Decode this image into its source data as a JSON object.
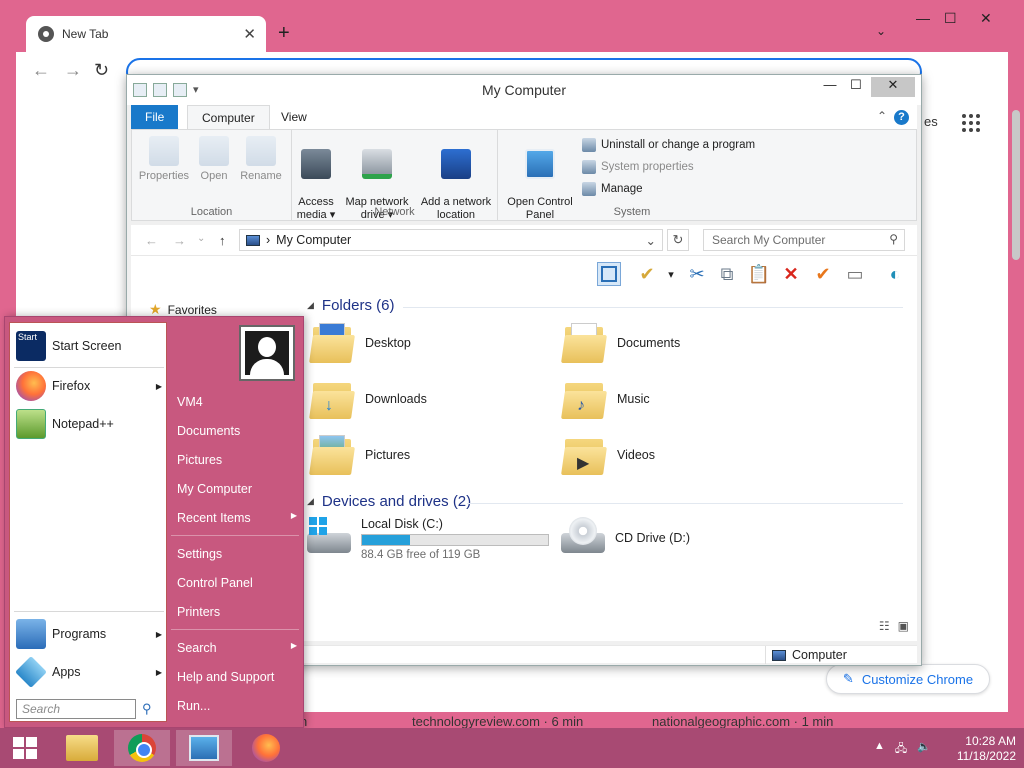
{
  "chrome": {
    "tab_title": "New Tab",
    "tab_close": "✕",
    "new_tab": "+",
    "tab_search": "⌄",
    "minimize": "—",
    "maximize": "☐",
    "close": "✕",
    "back": "←",
    "forward": "→",
    "reload": "↻",
    "signin_fragment": "es",
    "customize_label": "Customize Chrome",
    "news": [
      "n",
      "technologyreview.com · 6 min",
      "nationalgeographic.com · 1 min"
    ]
  },
  "explorer": {
    "title": "My Computer",
    "minimize": "—",
    "maximize": "☐",
    "close": "✕",
    "tabs": {
      "file": "File",
      "computer": "Computer",
      "view": "View"
    },
    "help": "?",
    "collapse": "⌃",
    "ribbon": {
      "location": {
        "label": "Location",
        "properties": "Properties",
        "open": "Open",
        "rename": "Rename"
      },
      "network": {
        "label": "Network",
        "access_media": "Access\nmedia ▾",
        "map_network_drive": "Map network\ndrive ▾",
        "add_network_location": "Add a network\nlocation"
      },
      "system": {
        "label": "System",
        "open_control_panel": "Open Control\nPanel",
        "uninstall": "Uninstall or change a program",
        "system_properties": "System properties",
        "manage": "Manage"
      }
    },
    "address": {
      "back": "←",
      "forward": "→",
      "recent": "⌄",
      "up": "↑",
      "separator": "›",
      "path": "My Computer",
      "dropdown": "⌄",
      "refresh": "↻",
      "search_placeholder": "Search My Computer",
      "search_icon": "⚲"
    },
    "nav": {
      "favorites": "Favorites"
    },
    "folders_header": "Folders (6)",
    "folders": [
      {
        "name": "Desktop",
        "badge": ""
      },
      {
        "name": "Documents",
        "badge": ""
      },
      {
        "name": "Downloads",
        "badge": "↓"
      },
      {
        "name": "Music",
        "badge": "♪"
      },
      {
        "name": "Pictures",
        "badge": ""
      },
      {
        "name": "Videos",
        "badge": "▶"
      }
    ],
    "drives_header": "Devices and drives (2)",
    "drives": [
      {
        "name": "Local Disk (C:)",
        "free": "88.4 GB free of 119 GB",
        "used_fraction": 0.257
      },
      {
        "name": "CD Drive (D:)"
      }
    ],
    "status": "Computer"
  },
  "start_menu": {
    "left": {
      "start_screen": "Start Screen",
      "start_tile": "Start",
      "firefox": "Firefox",
      "notepad": "Notepad++",
      "programs": "Programs",
      "apps": "Apps",
      "arrow": "▶",
      "search_placeholder": "Search",
      "search_icon": "⚲"
    },
    "right": {
      "user": "VM4",
      "documents": "Documents",
      "pictures": "Pictures",
      "my_computer": "My Computer",
      "recent_items": "Recent Items",
      "settings": "Settings",
      "control_panel": "Control Panel",
      "printers": "Printers",
      "search": "Search",
      "help": "Help and Support",
      "run": "Run...",
      "arrow": "▶"
    }
  },
  "taskbar": {
    "time": "10:28 AM",
    "date": "11/18/2022",
    "tray_up": "▲",
    "tray_network": "🖧",
    "tray_volume": "🔈"
  },
  "icons": {
    "cut": "✂",
    "copy": "⧉",
    "paste": "📋",
    "delete": "✕",
    "check": "✔",
    "rename": "▭",
    "pencil": "✎",
    "globe": "◐",
    "drop": "▾",
    "details_view": "☷",
    "tiles_view": "▣"
  }
}
